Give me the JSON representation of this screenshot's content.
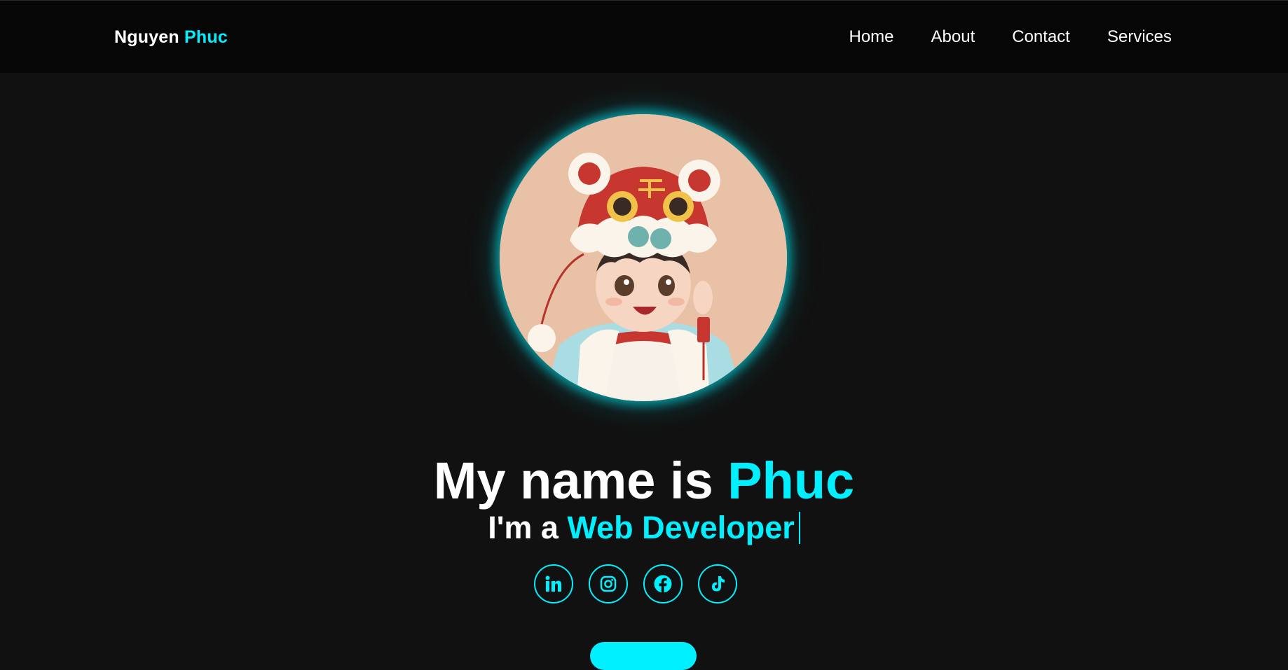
{
  "brand": {
    "first": "Nguyen",
    "last": "Phuc"
  },
  "nav": {
    "items": [
      {
        "label": "Home"
      },
      {
        "label": "About"
      },
      {
        "label": "Contact"
      },
      {
        "label": "Services"
      }
    ]
  },
  "hero": {
    "headline_prefix": "My name is",
    "headline_name": "Phuc",
    "sub_prefix": "I'm a",
    "sub_role": "Web Developer"
  },
  "socials": [
    {
      "icon": "linkedin-icon"
    },
    {
      "icon": "instagram-icon"
    },
    {
      "icon": "facebook-icon"
    },
    {
      "icon": "tiktok-icon"
    }
  ],
  "colors": {
    "accent": "#00f0ff",
    "background": "#111111",
    "navbar": "#060606",
    "text": "#ffffff"
  }
}
